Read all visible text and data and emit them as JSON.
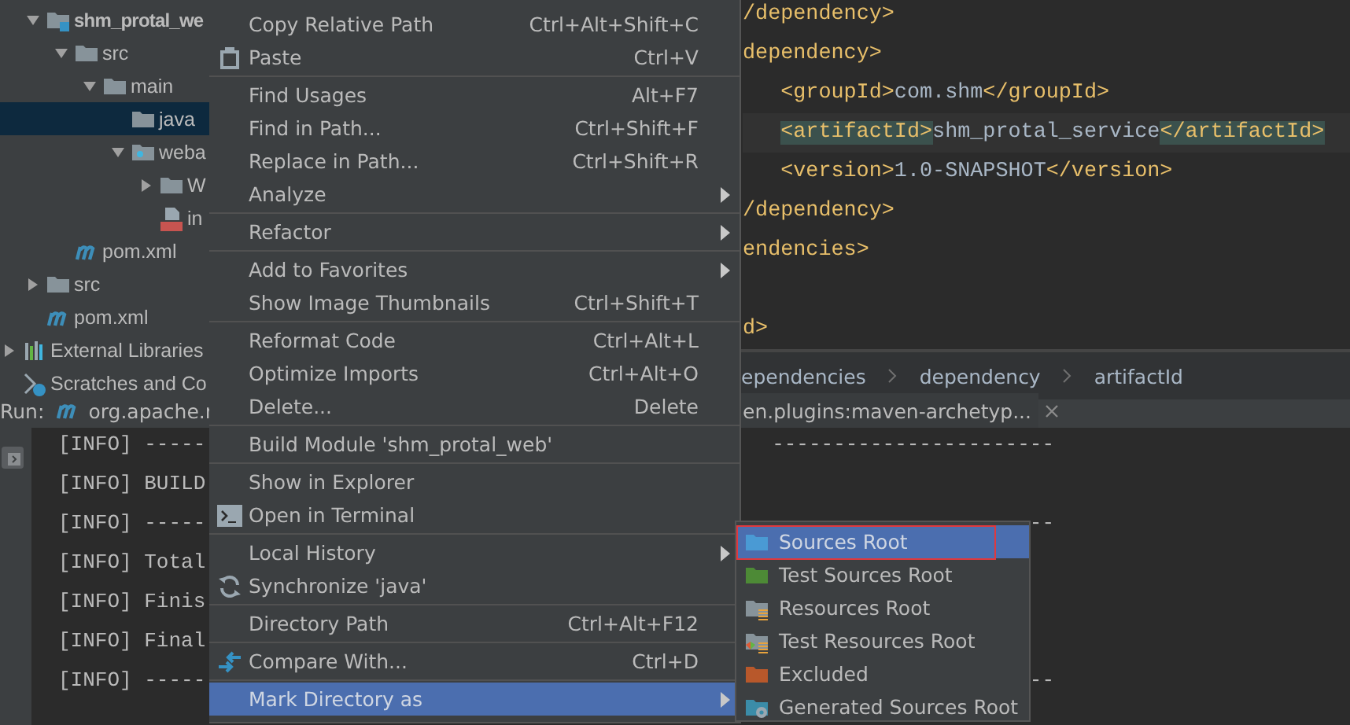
{
  "project_tree": {
    "nodes": [
      {
        "children": [
          {
            "label": "shm_protal_we",
            "kind": "module",
            "expanded": true,
            "selected": false,
            "children": [
              {
                "label": "src",
                "kind": "folder",
                "expanded": true,
                "selected": false,
                "children": [
                  {
                    "label": "main",
                    "kind": "folder",
                    "expanded": true,
                    "selected": false,
                    "children": [
                      {
                        "label": "java",
                        "kind": "folder",
                        "selected": true
                      },
                      {
                        "label": "weba",
                        "kind": "webfolder",
                        "expanded": true,
                        "selected": false,
                        "children": [
                          {
                            "label": "W",
                            "kind": "folder",
                            "expanded": false,
                            "selected": false
                          },
                          {
                            "label": "in",
                            "kind": "jsp",
                            "selected": false
                          }
                        ]
                      }
                    ]
                  }
                ]
              },
              {
                "label": "pom.xml",
                "kind": "maven",
                "selected": false
              }
            ]
          },
          {
            "label": "src",
            "kind": "folder",
            "expanded": false,
            "selected": false
          },
          {
            "label": "pom.xml",
            "kind": "maven",
            "selected": false
          }
        ]
      },
      {
        "label": "External Libraries",
        "kind": "libraries",
        "expanded": false,
        "selected": false
      },
      {
        "label": "Scratches and Co",
        "kind": "scratches",
        "selected": false
      }
    ]
  },
  "editor": {
    "lines": [
      {
        "kind": "code",
        "current": false,
        "tokens": [
          {
            "kind": "tag",
            "text": "/dependency>"
          }
        ]
      },
      {
        "kind": "code",
        "current": false,
        "tokens": [
          {
            "kind": "tag",
            "text": "dependency>"
          }
        ]
      },
      {
        "kind": "code",
        "current": false,
        "tokens": [
          {
            "kind": "indent"
          },
          {
            "kind": "tag",
            "text": "<groupId>"
          },
          {
            "kind": "text",
            "text": "com.shm"
          },
          {
            "kind": "tag",
            "text": "</groupId>"
          }
        ]
      },
      {
        "kind": "code",
        "current": true,
        "tokens": [
          {
            "kind": "indent"
          },
          {
            "kind": "tag-match",
            "text": "<artifactId>"
          },
          {
            "kind": "text",
            "text": "shm_protal_service"
          },
          {
            "kind": "tag-match",
            "text": "</artifactId>"
          }
        ]
      },
      {
        "kind": "code",
        "current": false,
        "tokens": [
          {
            "kind": "indent"
          },
          {
            "kind": "tag",
            "text": "<version>"
          },
          {
            "kind": "text",
            "text": "1.0-SNAPSHOT"
          },
          {
            "kind": "tag",
            "text": "</version>"
          }
        ]
      },
      {
        "kind": "code",
        "current": false,
        "tokens": [
          {
            "kind": "tag",
            "text": "/dependency>"
          }
        ]
      },
      {
        "kind": "code",
        "current": false,
        "tokens": [
          {
            "kind": "tag",
            "text": "endencies>"
          }
        ]
      },
      {
        "kind": "blank"
      },
      {
        "kind": "code",
        "current": false,
        "tokens": [
          {
            "kind": "tag",
            "text": "d>"
          }
        ]
      }
    ],
    "breadcrumbs": [
      "ependencies",
      "dependency",
      "artifactId"
    ]
  },
  "run_bar": {
    "label": "Run:",
    "config": "org.apache.r",
    "tab": "en.plugins:maven-archetyp..."
  },
  "console": {
    "lines": [
      {
        "left": "[INFO] -----",
        "right": "-----------------------"
      },
      {
        "left": "[INFO] BUILD"
      },
      {
        "left": "[INFO] -----",
        "right": "--"
      },
      {
        "left": "[INFO] Total"
      },
      {
        "left": "[INFO] Finis"
      },
      {
        "left": "[INFO] Final"
      },
      {
        "left": "[INFO] -----",
        "right": "--"
      }
    ]
  },
  "context_menu": {
    "items": [
      {
        "kind": "item",
        "label": "Copy Relative Path",
        "shortcut": "Ctrl+Alt+Shift+C",
        "submenu": false,
        "selected": false
      },
      {
        "kind": "paste",
        "label": "Paste",
        "shortcut": "Ctrl+V",
        "submenu": false,
        "selected": false
      },
      {
        "kind": "separator"
      },
      {
        "kind": "item",
        "label": "Find Usages",
        "shortcut": "Alt+F7",
        "submenu": false,
        "selected": false
      },
      {
        "kind": "item",
        "label": "Find in Path...",
        "shortcut": "Ctrl+Shift+F",
        "submenu": false,
        "selected": false
      },
      {
        "kind": "item",
        "label": "Replace in Path...",
        "shortcut": "Ctrl+Shift+R",
        "submenu": false,
        "selected": false
      },
      {
        "kind": "item",
        "label": "Analyze",
        "submenu": true,
        "selected": false
      },
      {
        "kind": "separator"
      },
      {
        "kind": "item",
        "label": "Refactor",
        "submenu": true,
        "selected": false
      },
      {
        "kind": "separator"
      },
      {
        "kind": "item",
        "label": "Add to Favorites",
        "submenu": true,
        "selected": false
      },
      {
        "kind": "item",
        "label": "Show Image Thumbnails",
        "shortcut": "Ctrl+Shift+T",
        "submenu": false,
        "selected": false
      },
      {
        "kind": "separator"
      },
      {
        "kind": "item",
        "label": "Reformat Code",
        "shortcut": "Ctrl+Alt+L",
        "submenu": false,
        "selected": false
      },
      {
        "kind": "item",
        "label": "Optimize Imports",
        "shortcut": "Ctrl+Alt+O",
        "submenu": false,
        "selected": false
      },
      {
        "kind": "item",
        "label": "Delete...",
        "shortcut": "Delete",
        "submenu": false,
        "selected": false
      },
      {
        "kind": "separator"
      },
      {
        "kind": "item",
        "label": "Build Module 'shm_protal_web'",
        "submenu": false,
        "selected": false
      },
      {
        "kind": "separator"
      },
      {
        "kind": "item",
        "label": "Show in Explorer",
        "submenu": false,
        "selected": false
      },
      {
        "kind": "terminal",
        "label": "Open in Terminal",
        "submenu": false,
        "selected": false
      },
      {
        "kind": "separator"
      },
      {
        "kind": "item",
        "label": "Local History",
        "submenu": true,
        "selected": false
      },
      {
        "kind": "sync",
        "label": "Synchronize 'java'",
        "submenu": false,
        "selected": false
      },
      {
        "kind": "separator"
      },
      {
        "kind": "item",
        "label": "Directory Path",
        "shortcut": "Ctrl+Alt+F12",
        "submenu": false,
        "selected": false
      },
      {
        "kind": "separator"
      },
      {
        "kind": "compare",
        "label": "Compare With...",
        "shortcut": "Ctrl+D",
        "submenu": false,
        "selected": false
      },
      {
        "kind": "separator"
      },
      {
        "kind": "item",
        "label": "Mark Directory as",
        "submenu": true,
        "selected": true
      }
    ]
  },
  "submenu": {
    "items": [
      {
        "label": "Sources Root",
        "kind": "sources",
        "selected": true,
        "outlined": true
      },
      {
        "label": "Test Sources Root",
        "kind": "testsources",
        "selected": false,
        "outlined": false
      },
      {
        "label": "Resources Root",
        "kind": "resources",
        "selected": false,
        "outlined": false
      },
      {
        "label": "Test Resources Root",
        "kind": "testresources",
        "selected": false,
        "outlined": false
      },
      {
        "label": "Excluded",
        "kind": "excluded",
        "selected": false,
        "outlined": false
      },
      {
        "label": "Generated Sources Root",
        "kind": "generated",
        "selected": false,
        "outlined": false
      }
    ]
  }
}
